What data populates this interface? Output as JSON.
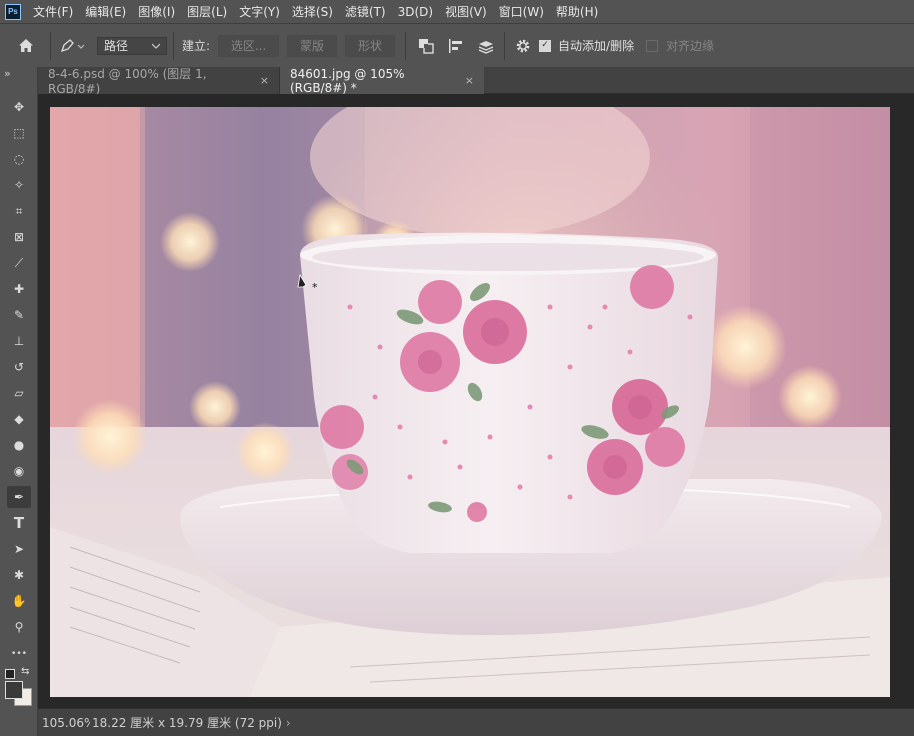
{
  "app": {
    "logo": "Ps"
  },
  "menu": [
    "文件(F)",
    "编辑(E)",
    "图像(I)",
    "图层(L)",
    "文字(Y)",
    "选择(S)",
    "滤镜(T)",
    "3D(D)",
    "视图(V)",
    "窗口(W)",
    "帮助(H)"
  ],
  "options": {
    "mode_value": "路径",
    "make_label": "建立:",
    "btn_selection": "选区...",
    "btn_mask": "蒙版",
    "btn_shape": "形状",
    "auto_add_delete_label": "自动添加/删除",
    "auto_add_delete_checked": true,
    "align_edges_label": "对齐边缘",
    "align_edges_checked": false
  },
  "tabs": [
    {
      "label": "8-4-6.psd @ 100% (图层 1, RGB/8#)",
      "close": "×",
      "active": false
    },
    {
      "label": "84601.jpg @ 105%(RGB/8#) *",
      "close": "×",
      "active": true
    }
  ],
  "toolbar": {
    "collapse": "»",
    "tools": [
      "move-icon",
      "marquee-icon",
      "lasso-icon",
      "magic-wand-icon",
      "crop-icon",
      "frame-icon",
      "eyedropper-icon",
      "healing-brush-icon",
      "brush-icon",
      "clone-stamp-icon",
      "history-brush-icon",
      "eraser-icon",
      "paint-bucket-icon",
      "blur-icon",
      "dodge-icon",
      "pen-icon",
      "type-icon",
      "path-selection-icon",
      "custom-shape-icon",
      "hand-icon",
      "zoom-icon",
      "more-tools-icon"
    ],
    "active_tool": "pen-icon"
  },
  "status": {
    "zoom": "105.06%",
    "dims": "18.22 厘米 x 19.79 厘米 (72 ppi)",
    "arrow": "›"
  },
  "colors": {
    "foreground": "#3a3a3a",
    "background": "#f2ece6"
  }
}
